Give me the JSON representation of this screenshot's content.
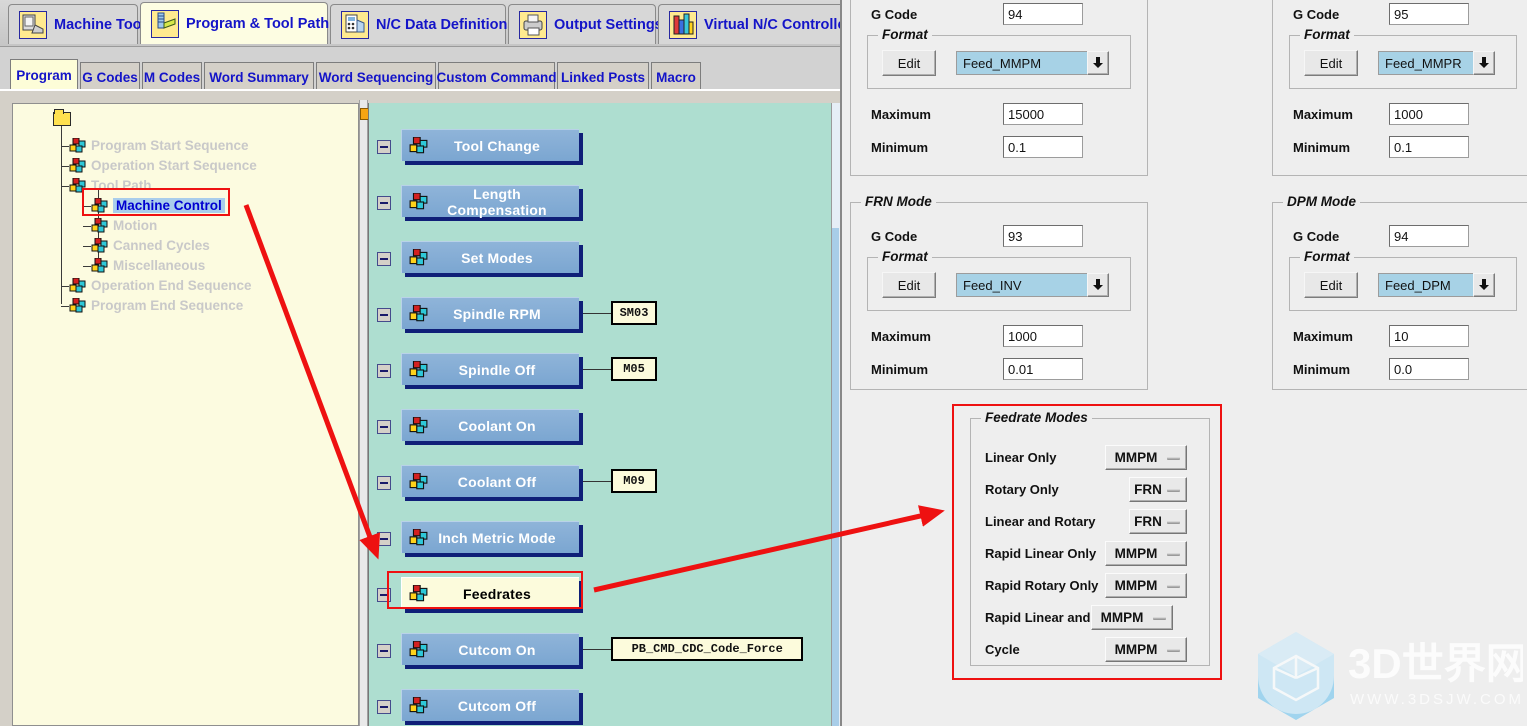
{
  "main_tabs": [
    {
      "label": "Machine Tool",
      "icon": "machine-tool-icon",
      "active": false
    },
    {
      "label": "Program & Tool Path",
      "icon": "program-tool-path-icon",
      "active": true
    },
    {
      "label": "N/C Data Definitions",
      "icon": "nc-data-definitions-icon",
      "active": false
    },
    {
      "label": "Output Settings",
      "icon": "printer-icon",
      "active": false
    },
    {
      "label": "Virtual N/C Controller",
      "icon": "virtual-nc-controller-icon",
      "active": false
    }
  ],
  "sub_tabs": [
    {
      "label": "Program",
      "active": true
    },
    {
      "label": "G Codes",
      "active": false
    },
    {
      "label": "M Codes",
      "active": false
    },
    {
      "label": "Word Summary",
      "active": false
    },
    {
      "label": "Word Sequencing",
      "active": false
    },
    {
      "label": "Custom Command",
      "active": false
    },
    {
      "label": "Linked Posts",
      "active": false
    },
    {
      "label": "Macro",
      "active": false
    }
  ],
  "tree": {
    "items": [
      {
        "label": "Program Start Sequence",
        "state": "dim",
        "indent": 0
      },
      {
        "label": "Operation Start Sequence",
        "state": "dim",
        "indent": 0
      },
      {
        "label": "Tool Path",
        "state": "dim",
        "indent": 0
      },
      {
        "label": "Machine Control",
        "state": "selected",
        "indent": 1
      },
      {
        "label": "Motion",
        "state": "dim",
        "indent": 1
      },
      {
        "label": "Canned Cycles",
        "state": "dim",
        "indent": 1
      },
      {
        "label": "Miscellaneous",
        "state": "dim",
        "indent": 1
      },
      {
        "label": "Operation End Sequence",
        "state": "dim",
        "indent": 0
      },
      {
        "label": "Program End Sequence",
        "state": "dim",
        "indent": 0
      }
    ]
  },
  "blocks": [
    {
      "label": "Tool Change",
      "tag": null,
      "highlight": false
    },
    {
      "label": "Length Compensation",
      "tag": null,
      "highlight": false
    },
    {
      "label": "Set Modes",
      "tag": null,
      "highlight": false
    },
    {
      "label": "Spindle RPM",
      "tag": "SM03",
      "highlight": false
    },
    {
      "label": "Spindle Off",
      "tag": "M05",
      "highlight": false
    },
    {
      "label": "Coolant On",
      "tag": null,
      "highlight": false
    },
    {
      "label": "Coolant Off",
      "tag": "M09",
      "highlight": false
    },
    {
      "label": "Inch Metric Mode",
      "tag": null,
      "highlight": false
    },
    {
      "label": "Feedrates",
      "tag": null,
      "highlight": true
    },
    {
      "label": "Cutcom On",
      "tag": "PB_CMD_CDC_Code_Force",
      "highlight": false
    },
    {
      "label": "Cutcom Off",
      "tag": null,
      "highlight": false
    }
  ],
  "right_panel": {
    "mode_groups": [
      {
        "title": "",
        "gcode_label": "G Code",
        "gcode_value": "94",
        "format_title": "Format",
        "edit_label": "Edit",
        "format_value": "Feed_MMPM",
        "maximum_label": "Maximum",
        "maximum_value": "15000",
        "minimum_label": "Minimum",
        "minimum_value": "0.1"
      },
      {
        "title": "",
        "gcode_label": "G Code",
        "gcode_value": "95",
        "format_title": "Format",
        "edit_label": "Edit",
        "format_value": "Feed_MMPR",
        "maximum_label": "Maximum",
        "maximum_value": "1000",
        "minimum_label": "Minimum",
        "minimum_value": "0.1"
      },
      {
        "title": "FRN Mode",
        "gcode_label": "G Code",
        "gcode_value": "93",
        "format_title": "Format",
        "edit_label": "Edit",
        "format_value": "Feed_INV",
        "maximum_label": "Maximum",
        "maximum_value": "1000",
        "minimum_label": "Minimum",
        "minimum_value": "0.01"
      },
      {
        "title": "DPM Mode",
        "gcode_label": "G Code",
        "gcode_value": "94",
        "format_title": "Format",
        "edit_label": "Edit",
        "format_value": "Feed_DPM",
        "maximum_label": "Maximum",
        "maximum_value": "10",
        "minimum_label": "Minimum",
        "minimum_value": "0.0"
      }
    ],
    "feedrate_modes": {
      "title": "Feedrate Modes",
      "rows": [
        {
          "label": "Linear Only",
          "value": "MMPM"
        },
        {
          "label": "Rotary Only",
          "value": "FRN"
        },
        {
          "label": "Linear and Rotary",
          "value": "FRN"
        },
        {
          "label": "Rapid Linear Only",
          "value": "MMPM"
        },
        {
          "label": "Rapid Rotary Only",
          "value": "MMPM"
        },
        {
          "label": "Rapid Linear and Rotary",
          "value": "MMPM"
        },
        {
          "label": "Cycle",
          "value": "MMPM"
        }
      ]
    }
  },
  "annotations": {
    "highlight_color": "#ee1111",
    "arrow_from_tree_to_feedrates": "Machine Control -> Feedrates",
    "arrow_from_feedrates_to_modes": "Feedrates -> Feedrate Modes"
  },
  "watermark": {
    "title": "3D世界网",
    "url": "WWW.3DSJW.COM"
  }
}
